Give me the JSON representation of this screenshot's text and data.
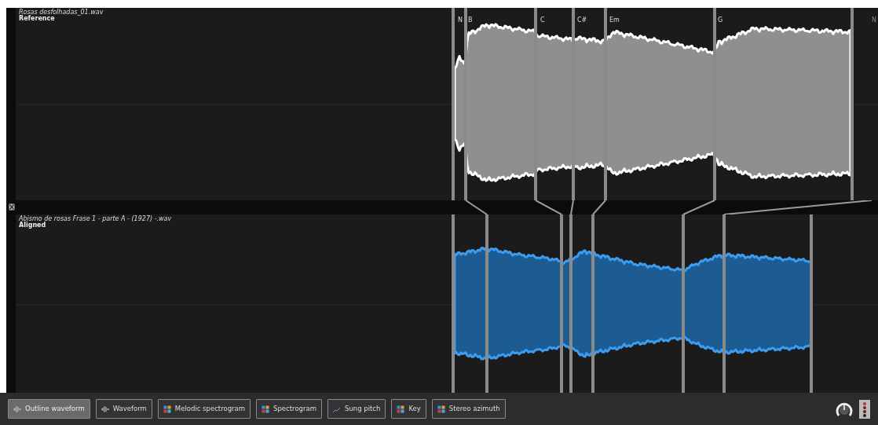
{
  "tracks": [
    {
      "file": "Rosas desfolhadas_01.wav",
      "role": "Reference",
      "chords": [
        {
          "label": "N",
          "dimmed": false
        },
        {
          "label": "B",
          "dimmed": false
        },
        {
          "label": "C",
          "dimmed": false
        },
        {
          "label": "C#",
          "dimmed": false
        },
        {
          "label": "Em",
          "dimmed": false
        },
        {
          "label": "G",
          "dimmed": false
        },
        {
          "label": "N",
          "dimmed": true
        }
      ]
    },
    {
      "file": "Abismo de rosas Frase 1 - parte A - (1927) -.wav",
      "role": "Aligned"
    }
  ],
  "toolbar": {
    "buttons": [
      {
        "label": "Outline waveform",
        "kind": "wave",
        "selected": true
      },
      {
        "label": "Waveform",
        "kind": "wave",
        "selected": false
      },
      {
        "label": "Melodic spectrogram",
        "kind": "grid",
        "selected": false
      },
      {
        "label": "Spectrogram",
        "kind": "grid",
        "selected": false
      },
      {
        "label": "Sung pitch",
        "kind": "pitch",
        "selected": false
      },
      {
        "label": "Key",
        "kind": "grid",
        "selected": false
      },
      {
        "label": "Stereo azimuth",
        "kind": "grid",
        "selected": false
      }
    ]
  }
}
